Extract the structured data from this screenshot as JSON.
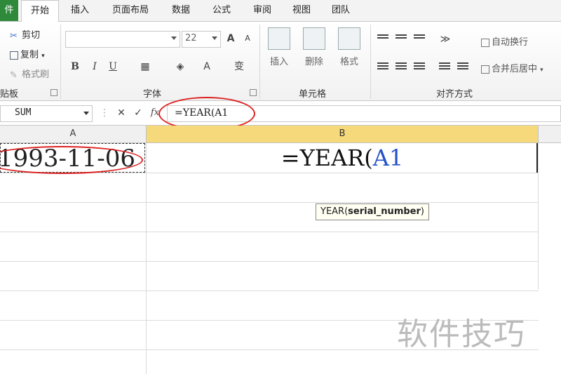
{
  "ribbon": {
    "tabs": [
      "件",
      "开始",
      "插入",
      "页面布局",
      "数据",
      "公式",
      "审阅",
      "视图",
      "团队"
    ],
    "active_tab": "开始",
    "clipboard": {
      "cut": "剪切",
      "copy": "复制",
      "format_painter": "格式刷",
      "label": "贴板"
    },
    "font": {
      "size": "22",
      "label": "字体",
      "bold": "B",
      "italic": "I",
      "underline": "U"
    },
    "cells": {
      "insert": "插入",
      "delete": "删除",
      "format": "格式",
      "label": "单元格"
    },
    "alignment": {
      "wrap_text": "自动换行",
      "merge_center": "合并后居中",
      "label": "对齐方式"
    }
  },
  "formula_bar": {
    "name_box": "SUM",
    "fx": "fx",
    "formula": "=YEAR(A1"
  },
  "grid": {
    "columns": [
      "A",
      "B"
    ],
    "cell_A1": "1993-11-06",
    "cell_B1_prefix": "=YEAR(",
    "cell_B1_ref": "A1",
    "tooltip_func": "YEAR(",
    "tooltip_arg": "serial_number",
    "tooltip_close": ")"
  },
  "watermark": "软件技巧",
  "colors": {
    "accent": "#d22222",
    "selected_header": "#f6d97a",
    "ref_blue": "#2451c7"
  }
}
